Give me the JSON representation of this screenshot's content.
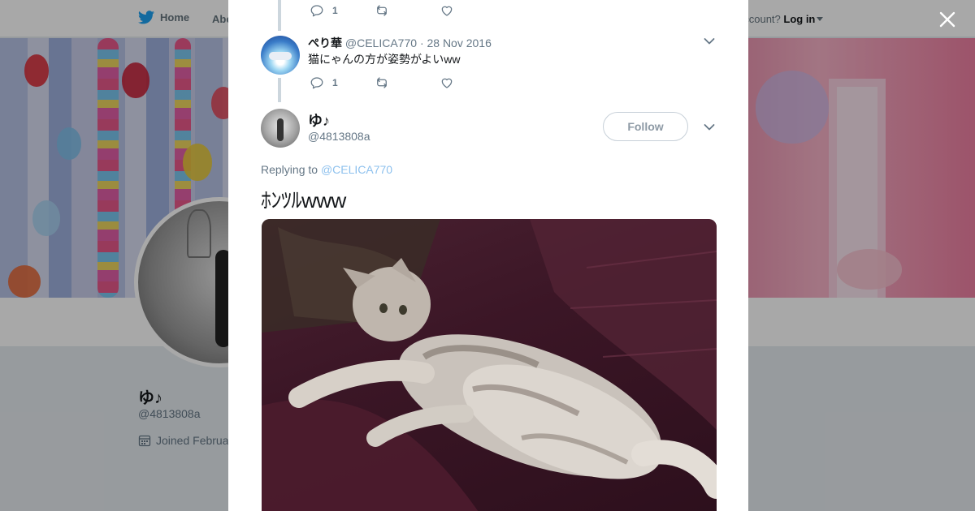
{
  "nav": {
    "home_label": "Home",
    "about_label": "Abo",
    "account_prompt": "account?",
    "login_label": "Log in"
  },
  "profile": {
    "name": "ゆ♪",
    "handle": "@4813808a",
    "joined_text": "Joined Februa"
  },
  "thread": {
    "top_actions": {
      "reply_count": "1",
      "retweet_count": "",
      "like_count": ""
    },
    "reply_tweet": {
      "author_name": "ぺり華",
      "author_handle": "@CELICA770",
      "date": "· 28 Nov 2016",
      "text": "猫にゃんの方が姿勢がよいww",
      "reply_count": "1"
    },
    "main_tweet": {
      "author_name": "ゆ♪",
      "author_handle": "@4813808a",
      "follow_label": "Follow",
      "replying_prefix": "Replying to",
      "replying_handle": "@CELICA770",
      "text": "ﾎﾝﾂﾙwww"
    }
  },
  "colors": {
    "twitter_blue": "#1da1f2",
    "muted_text": "#657786",
    "thread_line": "#ccd6dd"
  },
  "icons": [
    "twitter-bird-icon",
    "caret-down-icon",
    "calendar-icon",
    "close-icon",
    "reply-icon",
    "retweet-icon",
    "like-icon",
    "chevron-down-icon"
  ]
}
